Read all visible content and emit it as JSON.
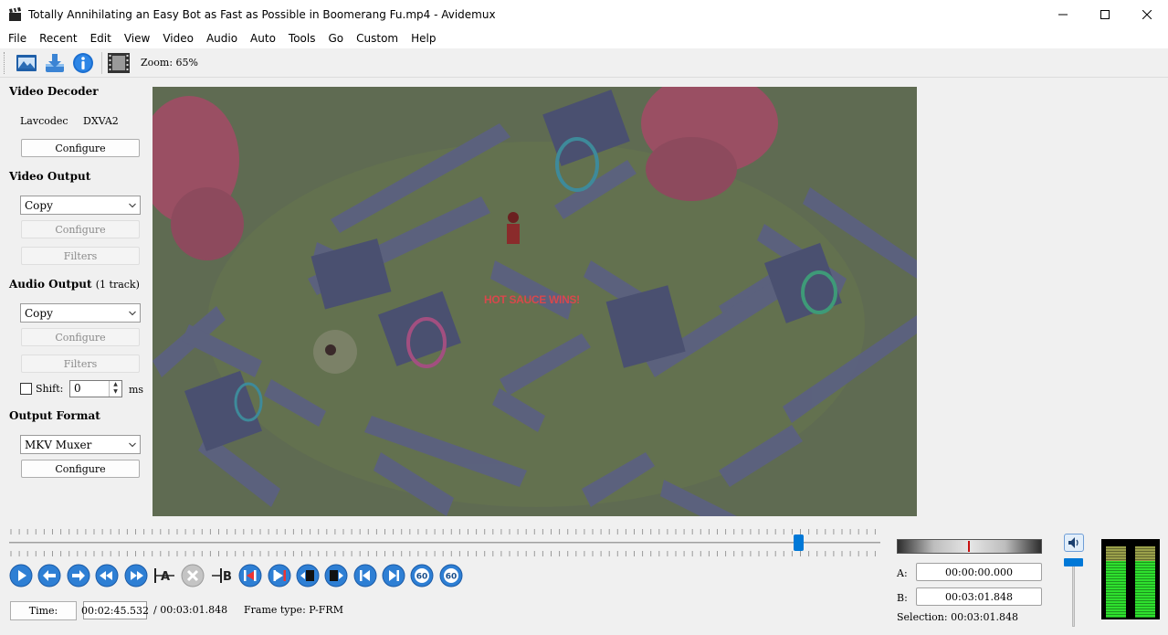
{
  "window": {
    "title": "Totally Annihilating an Easy Bot as Fast as Possible in Boomerang Fu.mp4 - Avidemux",
    "controls": [
      "minimize",
      "maximize",
      "close"
    ]
  },
  "menu": [
    "File",
    "Recent",
    "Edit",
    "View",
    "Video",
    "Audio",
    "Auto",
    "Tools",
    "Go",
    "Custom",
    "Help"
  ],
  "toolbar": {
    "icons": [
      "open-video-icon",
      "save-video-icon",
      "info-icon",
      "frame-filmstrip-icon"
    ],
    "zoom": "Zoom: 65%"
  },
  "video_decoder": {
    "title": "Video Decoder",
    "decoder_name": "Lavcodec",
    "decoder_hw": "DXVA2",
    "configure": "Configure"
  },
  "video_output": {
    "title": "Video Output",
    "selected": "Copy",
    "configure": "Configure",
    "filters": "Filters"
  },
  "audio_output": {
    "title": "Audio Output",
    "tracks": "(1 track)",
    "selected": "Copy",
    "configure": "Configure",
    "filters": "Filters",
    "shift_label": "Shift:",
    "shift_value": "0",
    "shift_unit": "ms"
  },
  "output_format": {
    "title": "Output Format",
    "selected": "MKV Muxer",
    "configure": "Configure"
  },
  "video": {
    "overlay_text": "HOT SAUCE WINS!"
  },
  "timeline": {
    "position": 0.906
  },
  "navigation": {
    "buttons": [
      "play-icon",
      "previous-frame-icon",
      "next-frame-icon",
      "previous-keyframe-icon",
      "next-keyframe-icon",
      "set-marker-a-icon",
      "delete-selection-icon",
      "set-marker-b-icon",
      "go-to-marker-a-icon",
      "go-to-marker-b-icon",
      "previous-black-frame-icon",
      "next-black-frame-icon",
      "go-to-first-frame-icon",
      "go-to-last-frame-icon",
      "back-60-seconds-icon",
      "forward-60-seconds-icon"
    ],
    "marker_a_text": "A",
    "marker_b_text": "B",
    "sixty": "60"
  },
  "time": {
    "button": "Time:",
    "current": "00:02:45.532",
    "total": "/ 00:03:01.848",
    "frame_type": "Frame type:  P-FRM"
  },
  "selection": {
    "a_label": "A:",
    "a_value": "00:00:00.000",
    "b_label": "B:",
    "b_value": "00:03:01.848",
    "summary": "Selection: 00:03:01.848"
  },
  "audio": {
    "volume_level": 0.95,
    "meter_levels": [
      1.0,
      1.0
    ]
  },
  "colors": {
    "accent": "#0078d7",
    "nav_button": "#2e7fd4",
    "meter_green": "#2ee02e"
  }
}
